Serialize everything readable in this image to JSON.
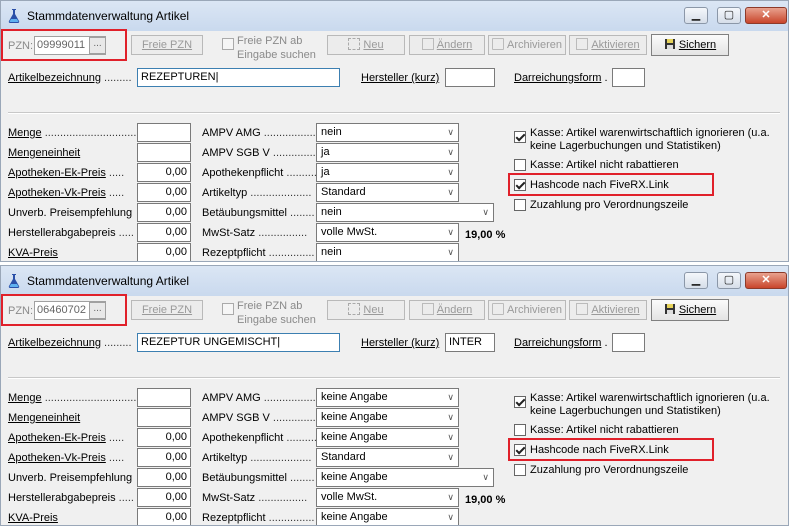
{
  "panels": [
    {
      "title": "Stammdatenverwaltung Artikel",
      "pzn_label": "PZN:",
      "pzn_value": "09999011",
      "pzn_btn": "...",
      "freie_pzn": "Freie PZN",
      "freie_pzn_search_line1": "Freie PZN ab",
      "freie_pzn_search_line2": "Eingabe suchen",
      "btn_neu": "Neu",
      "btn_aendern": "Ändern",
      "btn_archivieren": "Archivieren",
      "btn_aktivieren": "Aktivieren",
      "btn_sichern": "Sichern",
      "artikelbezeichnung_label": "Artikelbezeichnung",
      "artikelbezeichnung_value": "REZEPTUREN",
      "hersteller_label": "Hersteller (kurz)",
      "hersteller_value": "",
      "darreichungsform_label": "Darreichungsform",
      "darreichungsform_value": "",
      "left_labels": [
        "Menge",
        "Mengeneinheit",
        "Apotheken-Ek-Preis",
        "Apotheken-Vk-Preis",
        "Unverb. Preisempfehlung",
        "Herstellerabgabepreis",
        "KVA-Preis"
      ],
      "left_values": [
        "",
        "",
        "0,00",
        "0,00",
        "0,00",
        "0,00",
        "0,00"
      ],
      "mid_labels": [
        "AMPV AMG",
        "AMPV SGB V",
        "Apothekenpflicht",
        "Artikeltyp",
        "Betäubungsmittel",
        "MwSt-Satz",
        "Rezeptpflicht"
      ],
      "mid_values": [
        "nein",
        "ja",
        "ja",
        "Standard",
        "nein",
        "volle MwSt.",
        "nein"
      ],
      "mwst_rate": "19,00 %",
      "kasse_ignorieren_line1": "Kasse: Artikel warenwirtschaftlich ignorieren (u.a.",
      "kasse_ignorieren_line2": "keine Lagerbuchungen und Statistiken)",
      "kasse_nicht_rabattieren": "Kasse: Artikel nicht rabattieren",
      "hashcode": "Hashcode nach FiveRX.Link",
      "zuzahlung": "Zuzahlung pro Verordnungszeile",
      "checks": {
        "ignorieren": true,
        "rabattieren": false,
        "hashcode": true,
        "zuzahlung": false
      }
    },
    {
      "title": "Stammdatenverwaltung Artikel",
      "pzn_label": "PZN:",
      "pzn_value": "06460702",
      "pzn_btn": "...",
      "freie_pzn": "Freie PZN",
      "freie_pzn_search_line1": "Freie PZN ab",
      "freie_pzn_search_line2": "Eingabe suchen",
      "btn_neu": "Neu",
      "btn_aendern": "Ändern",
      "btn_archivieren": "Archivieren",
      "btn_aktivieren": "Aktivieren",
      "btn_sichern": "Sichern",
      "artikelbezeichnung_label": "Artikelbezeichnung",
      "artikelbezeichnung_value": "REZEPTUR UNGEMISCHT",
      "hersteller_label": "Hersteller (kurz)",
      "hersteller_value": "INTER",
      "darreichungsform_label": "Darreichungsform",
      "darreichungsform_value": "",
      "left_labels": [
        "Menge",
        "Mengeneinheit",
        "Apotheken-Ek-Preis",
        "Apotheken-Vk-Preis",
        "Unverb. Preisempfehlung",
        "Herstellerabgabepreis",
        "KVA-Preis"
      ],
      "left_values": [
        "",
        "",
        "0,00",
        "0,00",
        "0,00",
        "0,00",
        "0,00"
      ],
      "mid_labels": [
        "AMPV AMG",
        "AMPV SGB V",
        "Apothekenpflicht",
        "Artikeltyp",
        "Betäubungsmittel",
        "MwSt-Satz",
        "Rezeptpflicht"
      ],
      "mid_values": [
        "keine Angabe",
        "keine Angabe",
        "keine Angabe",
        "Standard",
        "keine Angabe",
        "volle MwSt.",
        "keine Angabe"
      ],
      "mwst_rate": "19,00 %",
      "kasse_ignorieren_line1": "Kasse: Artikel warenwirtschaftlich ignorieren (u.a.",
      "kasse_ignorieren_line2": "keine Lagerbuchungen und Statistiken)",
      "kasse_nicht_rabattieren": "Kasse: Artikel nicht rabattieren",
      "hashcode": "Hashcode nach FiveRX.Link",
      "zuzahlung": "Zuzahlung pro Verordnungszeile",
      "checks": {
        "ignorieren": true,
        "rabattieren": false,
        "hashcode": true,
        "zuzahlung": false
      }
    }
  ],
  "colors": {
    "highlight": "#e0202a",
    "titlebar": "#c9d9ee",
    "window": "#f0f0f0"
  }
}
